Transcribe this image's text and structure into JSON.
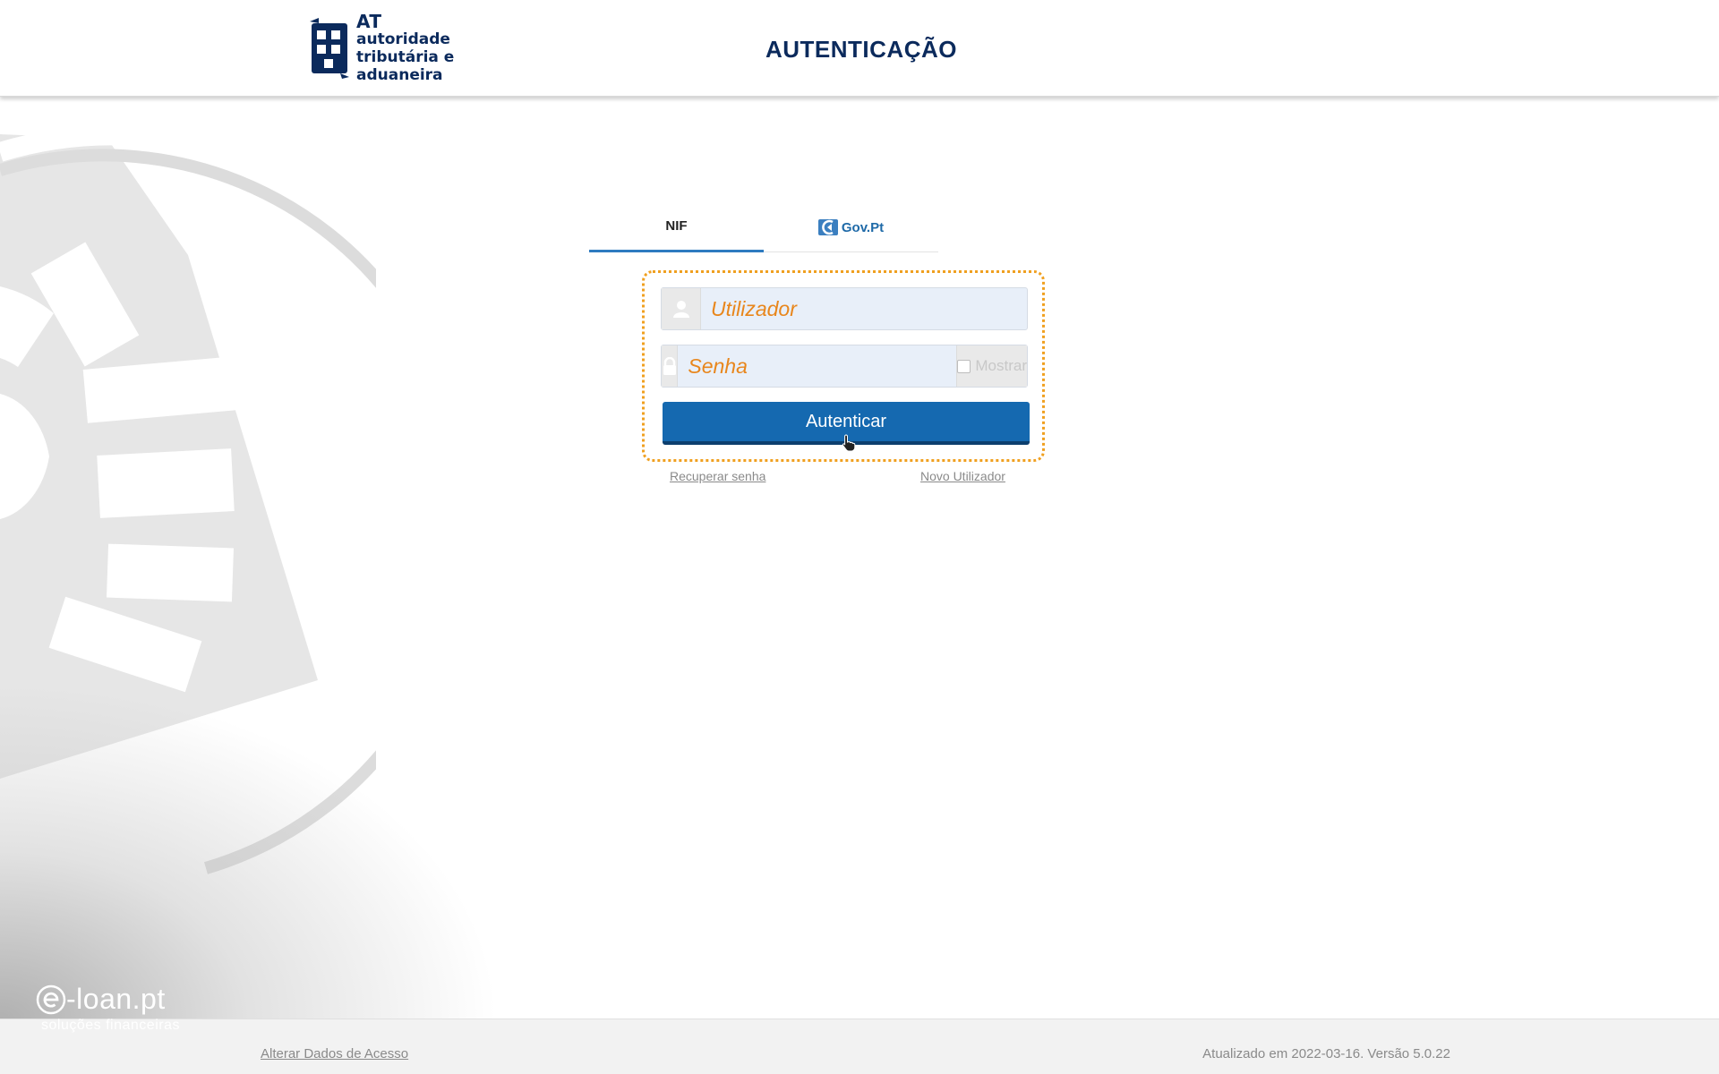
{
  "header": {
    "logo": {
      "line1": "AT",
      "line2": "autoridade",
      "line3": "tributária e aduaneira"
    },
    "title": "AUTENTICAÇÃO"
  },
  "tabs": [
    {
      "label": "NIF",
      "active": true
    },
    {
      "label": "Gov.Pt",
      "active": false
    }
  ],
  "login": {
    "username_placeholder": "Utilizador",
    "password_placeholder": "Senha",
    "show_password_label": "Mostrar",
    "submit_label": "Autenticar"
  },
  "links": {
    "recover_password": "Recuperar senha",
    "new_user": "Novo Utilizador"
  },
  "footer": {
    "change_access": "Alterar Dados de Acesso",
    "version": "Atualizado em 2022-03-16. Versão 5.0.22"
  },
  "branding": {
    "name": "-loan.pt",
    "tagline": "soluções financeiras"
  },
  "colors": {
    "accent_blue": "#1569b0",
    "placeholder_orange": "#e8861c",
    "dotted_border": "#f0a020",
    "title_navy": "#0b2a5c"
  }
}
